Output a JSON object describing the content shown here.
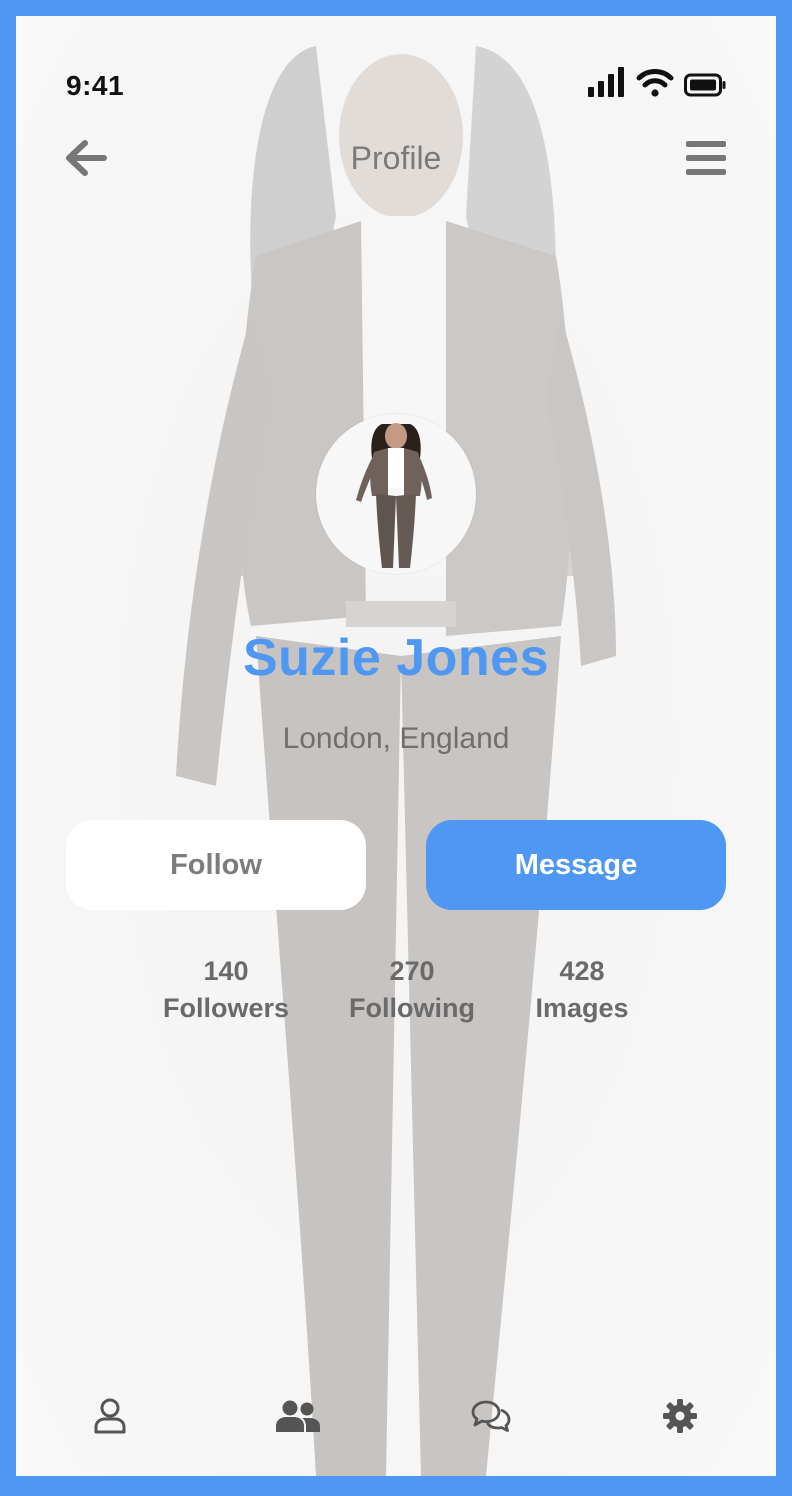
{
  "status_bar": {
    "time": "9:41"
  },
  "nav": {
    "title": "Profile",
    "back_icon": "arrow-left-icon",
    "menu_icon": "hamburger-menu-icon"
  },
  "profile": {
    "name": "Suzie Jones",
    "location": "London, England"
  },
  "actions": {
    "follow_label": "Follow",
    "message_label": "Message"
  },
  "stats": [
    {
      "count": "140",
      "label": "Followers"
    },
    {
      "count": "270",
      "label": "Following"
    },
    {
      "count": "428",
      "label": "Images"
    }
  ],
  "tab_bar": {
    "items": [
      "user-icon",
      "users-icon",
      "comments-icon",
      "gear-icon"
    ]
  },
  "colors": {
    "frame": "#4e97f2",
    "accent": "#4e97f2",
    "text_muted": "#6f6f6f",
    "icon": "#555555"
  }
}
